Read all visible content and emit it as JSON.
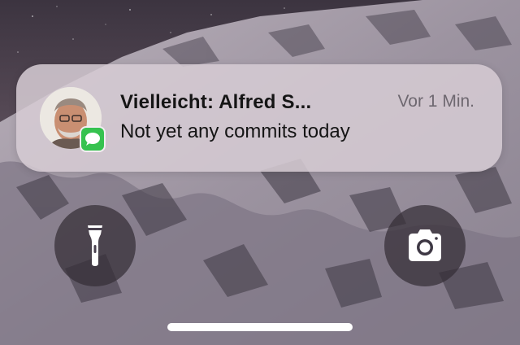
{
  "notification": {
    "sender": "Vielleicht: Alfred S...",
    "timestamp": "Vor 1 Min.",
    "message": "Not yet any commits today",
    "avatar_icon": "contact-photo",
    "app_icon": "messages-icon",
    "app_color": "#36c24f"
  },
  "lockscreen": {
    "left_button_icon": "flashlight-icon",
    "right_button_icon": "camera-icon"
  }
}
